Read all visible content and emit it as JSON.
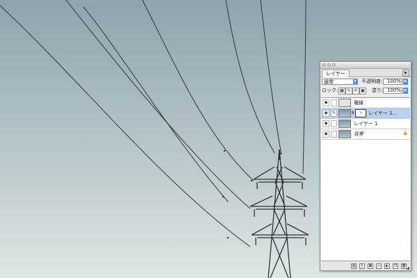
{
  "palette": {
    "tab_label": "レイヤー",
    "blend_mode": "通常",
    "opacity_label": "不透明度:",
    "opacity_value": "100%",
    "lock_label": "ロック:",
    "fill_label": "塗り:",
    "fill_value": "100%",
    "layers": [
      {
        "name": "電線",
        "visible": true,
        "thumb": "transparent",
        "selected": false,
        "italic": false,
        "locked": false
      },
      {
        "name": "レイヤー 1...",
        "visible": true,
        "thumb": "sky",
        "selected": true,
        "has_mask": true,
        "italic": false,
        "locked": false
      },
      {
        "name": "レイヤー 1",
        "visible": true,
        "thumb": "sky",
        "selected": false,
        "italic": false,
        "locked": false
      },
      {
        "name": "背景",
        "visible": true,
        "thumb": "sky",
        "selected": false,
        "italic": true,
        "locked": true
      }
    ]
  },
  "icons": {
    "eye": "eye-icon",
    "brush_link": "brush-icon",
    "chain": "chain-link-icon",
    "lock": "lock-icon",
    "bottom": [
      "link-layers-icon",
      "layer-style-icon",
      "add-mask-icon",
      "new-set-icon",
      "adjustment-layer-icon",
      "new-layer-icon",
      "trash-icon"
    ]
  },
  "colors": {
    "sky_top": "#8ea3ad",
    "sky_bottom": "#dfe6e6",
    "selection": "#b9d0ef",
    "accent": "#5a8fd8"
  }
}
